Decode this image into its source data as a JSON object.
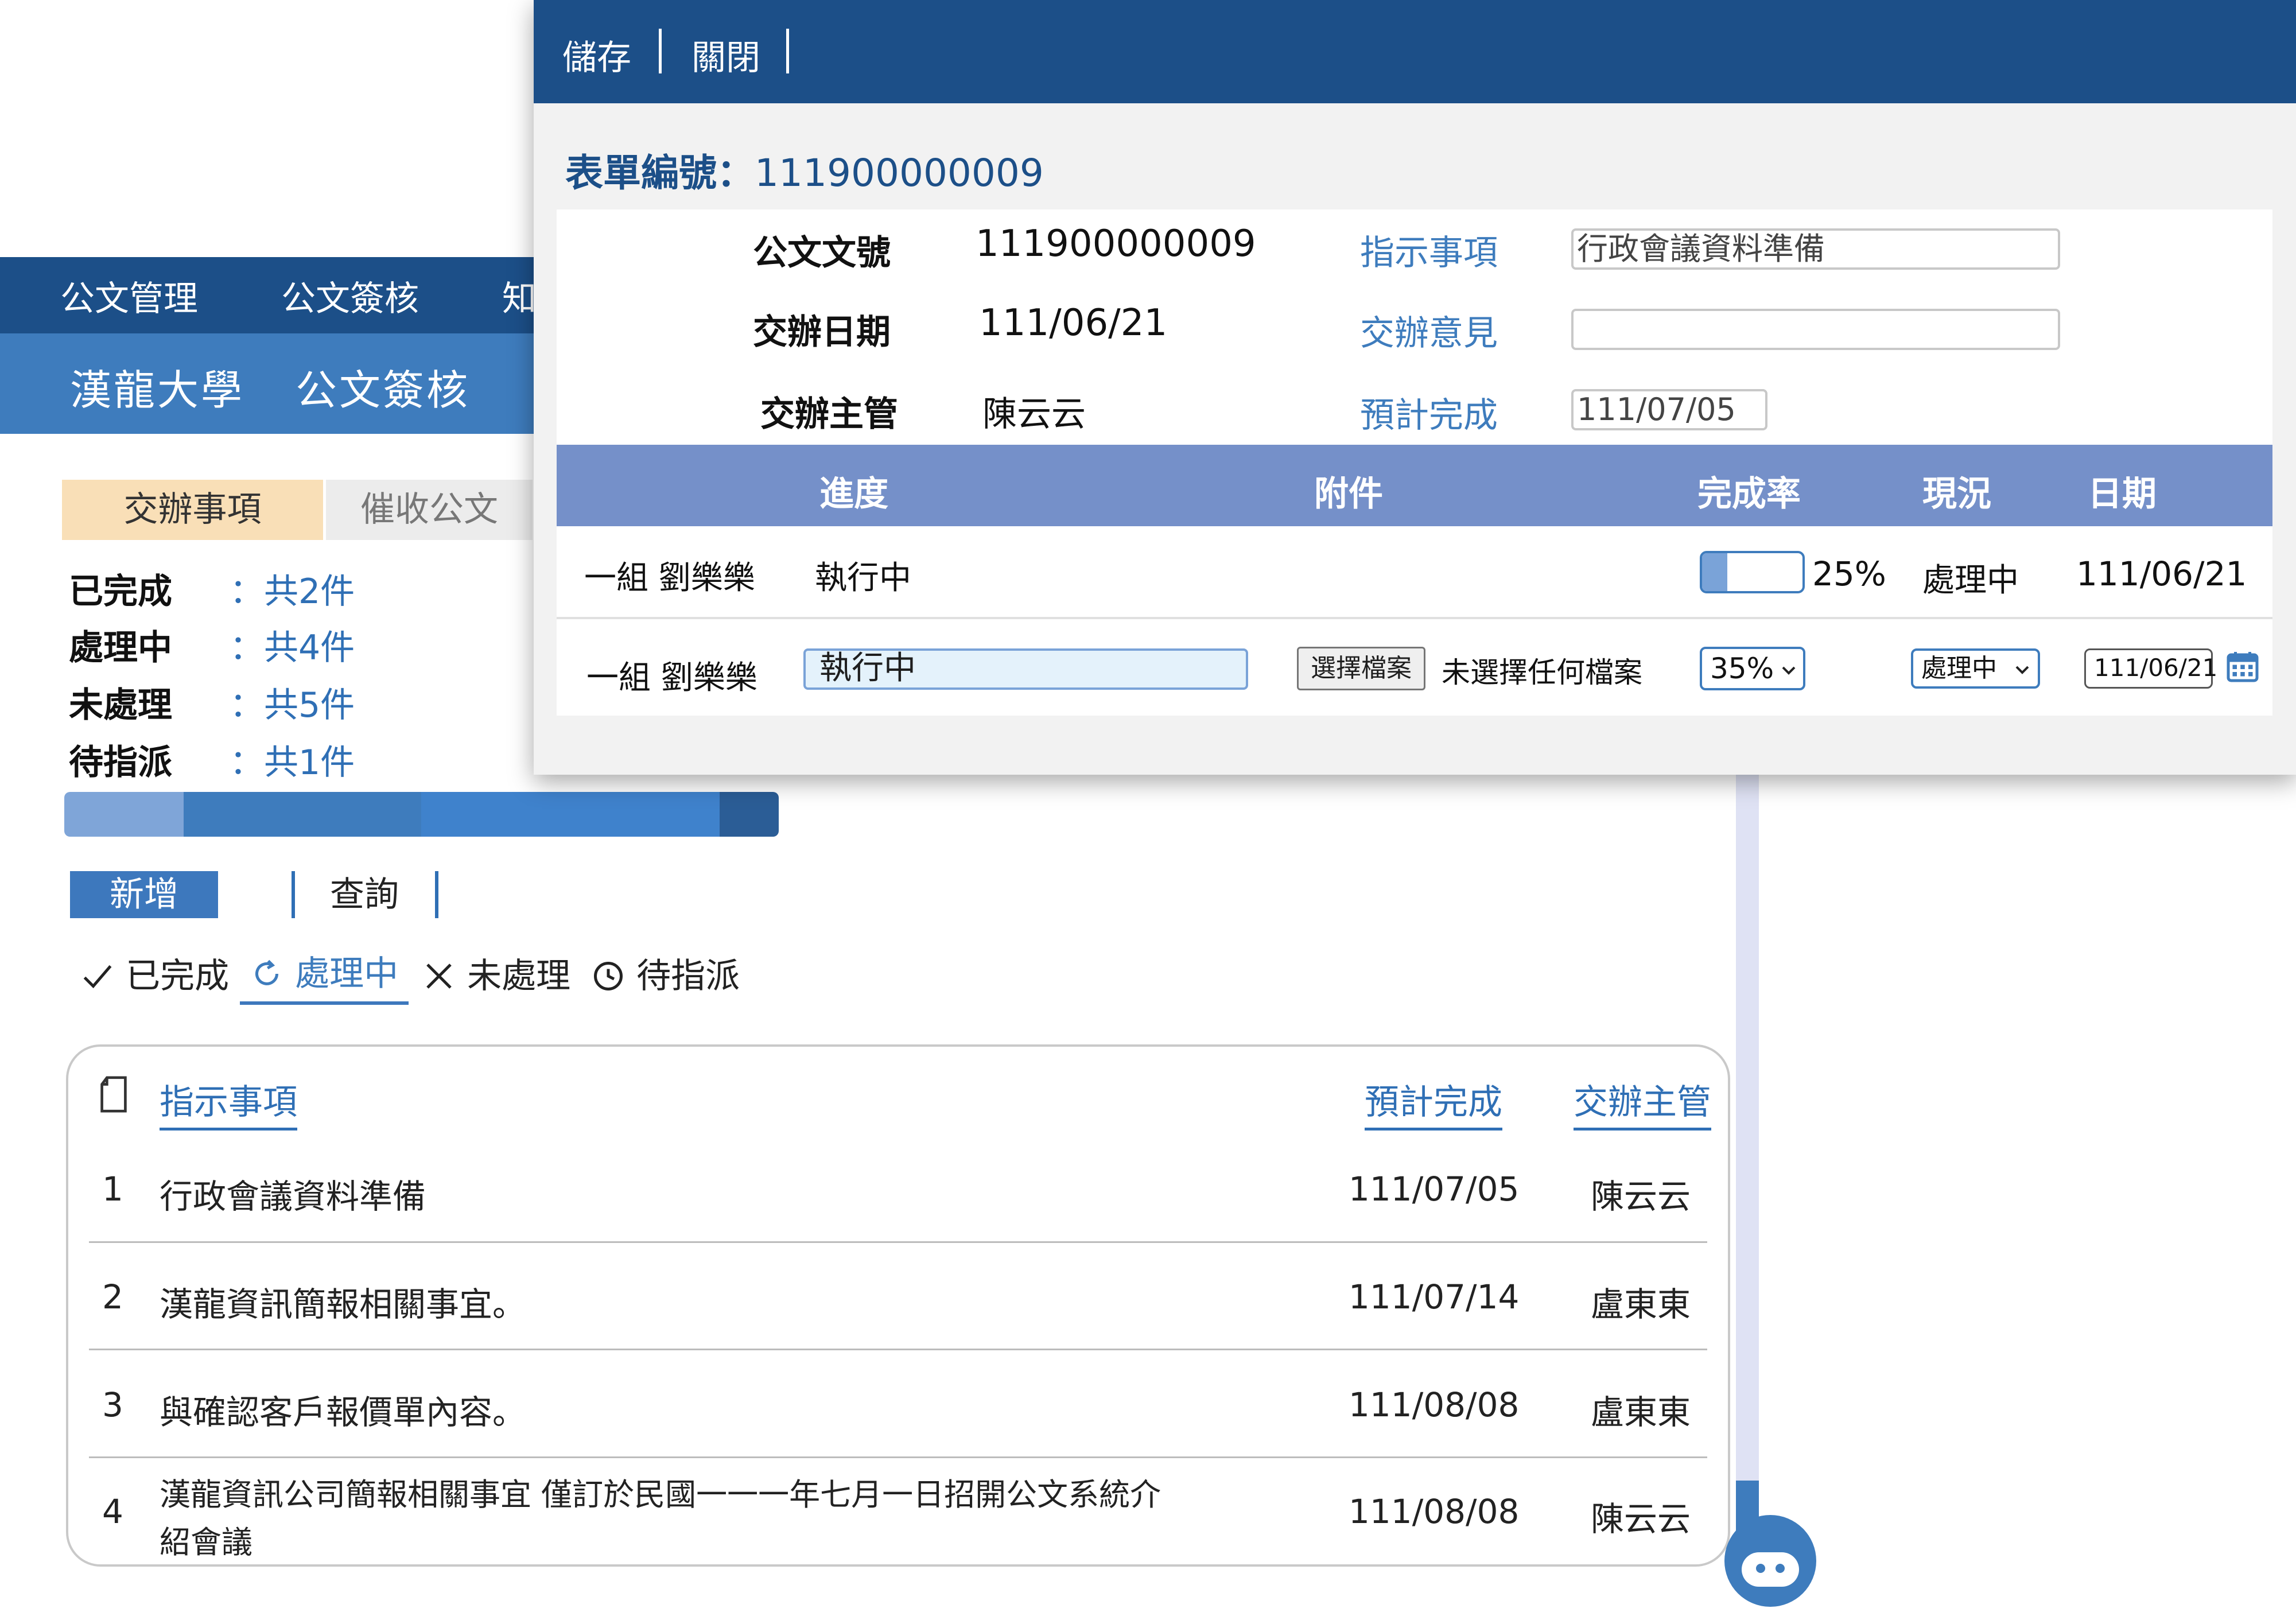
{
  "top_nav": [
    "公文管理",
    "公文簽核",
    "知"
  ],
  "sub_nav": {
    "org": "漢龍大學",
    "section": "公文簽核"
  },
  "tabs": {
    "active": "交辦事項",
    "inactive": "催收公文"
  },
  "stats": [
    {
      "label": "已完成",
      "value": "：共2件"
    },
    {
      "label": "處理中",
      "value": "：共4件"
    },
    {
      "label": "未處理",
      "value": "：共5件"
    },
    {
      "label": "待指派",
      "value": "：共1件"
    }
  ],
  "progress_segments": [
    {
      "name": "已完成",
      "fraction": 0.167,
      "color": "#7fa5d8"
    },
    {
      "name": "處理中",
      "fraction": 0.333,
      "color": "#3e7cbd"
    },
    {
      "name": "未處理",
      "fraction": 0.417,
      "color": "#3f82cc"
    },
    {
      "name": "待指派",
      "fraction": 0.083,
      "color": "#2b5d96"
    }
  ],
  "actions": {
    "add": "新增",
    "search": "查詢"
  },
  "filters": [
    {
      "icon": "check-icon",
      "label": "已完成"
    },
    {
      "icon": "refresh-icon",
      "label": "處理中",
      "active": true
    },
    {
      "icon": "close-icon",
      "label": "未處理"
    },
    {
      "icon": "clock-icon",
      "label": "待指派"
    }
  ],
  "table": {
    "headers": {
      "item": "指示事項",
      "due": "預計完成",
      "supervisor": "交辦主管"
    },
    "rows": [
      {
        "no": "1",
        "item": "行政會議資料準備",
        "item2": "",
        "due": "111/07/05",
        "supervisor": "陳云云"
      },
      {
        "no": "2",
        "item": "漢龍資訊簡報相關事宜。",
        "item2": "",
        "due": "111/07/14",
        "supervisor": "盧東東"
      },
      {
        "no": "3",
        "item": "與確認客戶報價單內容。",
        "item2": "",
        "due": "111/08/08",
        "supervisor": "盧東東"
      },
      {
        "no": "4",
        "item": "漢龍資訊公司簡報相關事宜 僅訂於民國一一一年七月一日招開公文系統介",
        "item2": "紹會議",
        "due": "111/08/08",
        "supervisor": "陳云云"
      }
    ]
  },
  "modal": {
    "save": "儲存",
    "close": "關閉",
    "form_no_label": "表單編號：",
    "form_no": "111900000009",
    "fields": {
      "doc_no_label": "公文文號",
      "doc_no": "111900000009",
      "assign_date_label": "交辦日期",
      "assign_date": "111/06/21",
      "supervisor_label": "交辦主管",
      "supervisor": "陳云云",
      "instruction_label": "指示事項",
      "instruction": "行政會議資料準備",
      "opinion_label": "交辦意見",
      "opinion": "",
      "due_label": "預計完成",
      "due": "111/07/05"
    },
    "grid": {
      "headers": {
        "progress": "進度",
        "attachment": "附件",
        "rate": "完成率",
        "status": "現況",
        "date": "日期"
      },
      "row1": {
        "assignee": "一組 劉樂樂",
        "progress": "執行中",
        "rate": "25%",
        "rate_fraction": 0.25,
        "status": "處理中",
        "date": "111/06/21"
      },
      "row2": {
        "assignee": "一組 劉樂樂",
        "progress": "執行中",
        "file_button": "選擇檔案",
        "file_status": "未選擇任何檔案",
        "rate": "35%",
        "status": "處理中",
        "date": "111/06/21"
      }
    }
  }
}
